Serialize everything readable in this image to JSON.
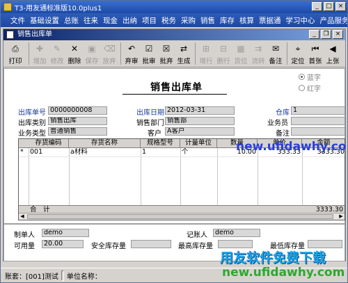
{
  "app": {
    "title": "T3-用友通标准版10.0plus1"
  },
  "menu": [
    "文件",
    "基础设置",
    "总账",
    "往来",
    "现金",
    "出纳",
    "项目",
    "税务",
    "采购",
    "销售",
    "库存",
    "核算",
    "票据通",
    "学习中心",
    "产品服务"
  ],
  "window": {
    "title": "销售出库单"
  },
  "toolbar": [
    {
      "label": "打印",
      "icon": "printer-icon",
      "glyph": "⎙",
      "disabled": false
    },
    {
      "label": "增加",
      "icon": "add-icon",
      "glyph": "✚",
      "disabled": true
    },
    {
      "label": "修改",
      "icon": "edit-icon",
      "glyph": "✎",
      "disabled": true
    },
    {
      "label": "删除",
      "icon": "delete-icon",
      "glyph": "✕",
      "disabled": false
    },
    {
      "label": "保存",
      "icon": "save-icon",
      "glyph": "▣",
      "disabled": true
    },
    {
      "label": "放弃",
      "icon": "discard-icon",
      "glyph": "⌫",
      "disabled": true
    },
    {
      "label": "弃审",
      "icon": "unapprove-icon",
      "glyph": "↶",
      "disabled": false
    },
    {
      "label": "批审",
      "icon": "batch-approve-icon",
      "glyph": "☑",
      "disabled": false
    },
    {
      "label": "批弃",
      "icon": "batch-unapprove-icon",
      "glyph": "☒",
      "disabled": false
    },
    {
      "label": "生成",
      "icon": "generate-icon",
      "glyph": "⇄",
      "disabled": false
    },
    {
      "label": "增行",
      "icon": "add-row-icon",
      "glyph": "⊞",
      "disabled": true
    },
    {
      "label": "删行",
      "icon": "delete-row-icon",
      "glyph": "⊟",
      "disabled": true
    },
    {
      "label": "货位",
      "icon": "location-icon",
      "glyph": "▦",
      "disabled": true
    },
    {
      "label": "流转",
      "icon": "flow-icon",
      "glyph": "⇉",
      "disabled": true
    },
    {
      "label": "备注",
      "icon": "note-icon",
      "glyph": "✉",
      "disabled": false
    },
    {
      "label": "定位",
      "icon": "locate-icon",
      "glyph": "⌖",
      "disabled": false
    },
    {
      "label": "首张",
      "icon": "first-icon",
      "glyph": "⏮",
      "disabled": false
    },
    {
      "label": "上张",
      "icon": "previous-icon",
      "glyph": "◀",
      "disabled": false
    }
  ],
  "radios": {
    "blue": "蓝字",
    "red": "红字"
  },
  "form": {
    "title": "销售出库单",
    "order_no_label": "出库单号",
    "order_no": "0000000008",
    "date_label": "出库日期",
    "date": "2012-03-31",
    "warehouse_label": "仓库",
    "warehouse": "1",
    "category_label": "出库类别",
    "category": "销售出库",
    "dept_label": "销售部门",
    "dept": "销售部",
    "clerk_label": "业务员",
    "clerk": "",
    "biz_type_label": "业务类型",
    "biz_type": "普通销售",
    "customer_label": "客户",
    "customer": "A客户",
    "remark_label": "备注",
    "remark": ""
  },
  "grid": {
    "columns": [
      "存货编码",
      "存货名称",
      "规格型号",
      "计量单位",
      "数量",
      "单价",
      "金额"
    ],
    "rows": [
      {
        "marker": "*",
        "code": "001",
        "name": "a材料",
        "spec": "1",
        "unit": "个",
        "qty": "10.00",
        "price": "333.33",
        "amount": "3333.30"
      }
    ],
    "total_label": "合　计",
    "total_amount": "3333.30"
  },
  "footer": {
    "maker_label": "制单人",
    "maker": "demo",
    "bookkeeper_label": "记账人",
    "bookkeeper": "demo",
    "available_label": "可用量",
    "available": "20.00",
    "safety_label": "安全库存量",
    "safety": "",
    "max_label": "最高库存量",
    "max": "",
    "min_label": "最低库存量",
    "min": ""
  },
  "status": {
    "account": "账套：[001]测试",
    "unit": "单位名称："
  },
  "watermark": {
    "url": "new.ufidawhy.com",
    "slogan": "用友软件免费下载"
  }
}
